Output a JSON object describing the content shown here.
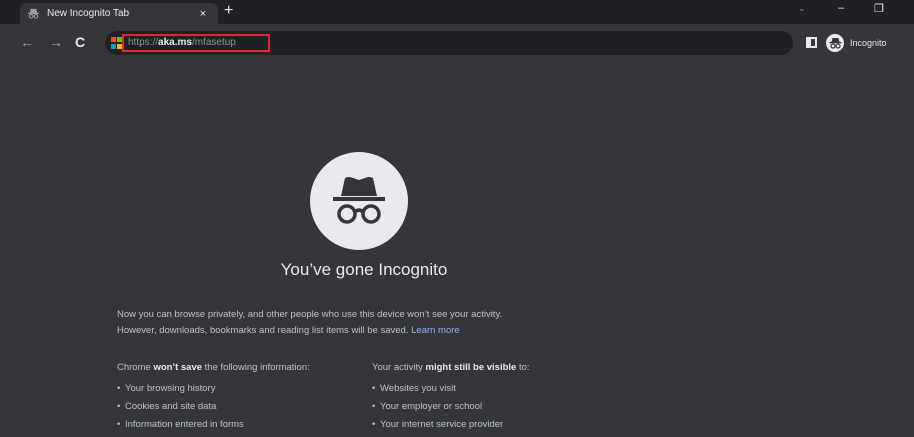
{
  "tab": {
    "title": "New Incognito Tab",
    "close": "×"
  },
  "newtab": "+",
  "window": {
    "tabsearch": "⌄",
    "minimize": "–",
    "restore": "❐"
  },
  "nav": {
    "back": "←",
    "forward": "→",
    "reload": "C"
  },
  "omnibox": {
    "scheme": "https://",
    "host": "aka.ms",
    "path": "/mfasetup",
    "highlight_color": "#e0272c"
  },
  "profile": {
    "label": "Incognito"
  },
  "page": {
    "heading": "You’ve gone Incognito",
    "intro_line1": "Now you can browse privately, and other people who use this device won’t see your activity.",
    "intro_line2": "However, downloads, bookmarks and reading list items will be saved.",
    "learn_more": "Learn more",
    "left_title_pre": "Chrome",
    "left_title_bold": "won’t save",
    "left_title_post": "the following information:",
    "left_items": [
      "Your browsing history",
      "Cookies and site data",
      "Information entered in forms"
    ],
    "right_title_pre": "Your activity",
    "right_title_bold": "might still be visible",
    "right_title_post": "to:",
    "right_items": [
      "Websites you visit",
      "Your employer or school",
      "Your internet service provider"
    ]
  },
  "colors": {
    "frame": "#202124",
    "background": "#35363a",
    "link": "#8ab4f8"
  }
}
